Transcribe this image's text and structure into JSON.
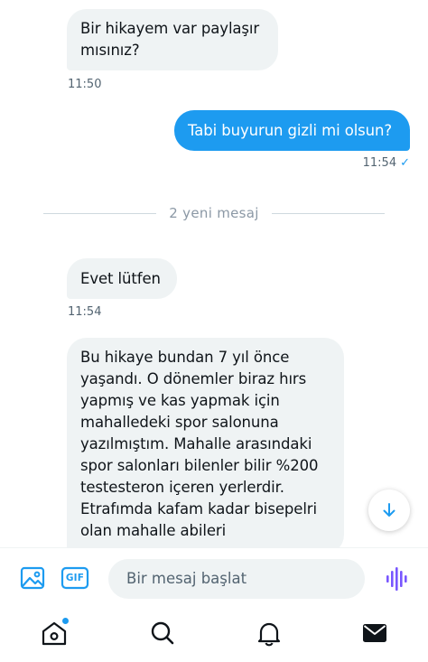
{
  "messages": [
    {
      "id": "m1",
      "direction": "incoming",
      "text": "Bir hikayem var paylaşır mısınız?",
      "time": "11:50"
    },
    {
      "id": "m2",
      "direction": "outgoing",
      "text": "Tabi buyurun gizli mi olsun?",
      "time": "11:54",
      "status_icon": "checkmark-icon"
    },
    {
      "id": "m3",
      "direction": "incoming",
      "text": "Evet lütfen",
      "time": "11:54"
    },
    {
      "id": "m4",
      "direction": "incoming",
      "text": "Bu hikaye bundan 7 yıl önce yaşandı. O dönemler biraz hırs yapmış ve kas yapmak için mahalledeki spor salonuna yazılmıştım. Mahalle arasındaki spor salonları bilenler bilir %200 testesteron içeren yerlerdir. Etrafımda kafam kadar bisepelri olan mahalle abileri"
    }
  ],
  "divider": {
    "label": "2 yeni mesaj"
  },
  "scroll_button": {
    "icon": "arrow-down-icon"
  },
  "composer": {
    "placeholder": "Bir mesaj başlat",
    "gif_label": "GIF",
    "icons": [
      "image-icon",
      "gif-icon",
      "voice-icon"
    ]
  },
  "tabbar": {
    "items": [
      {
        "name": "home",
        "icon": "home-icon",
        "has_notification_dot": true
      },
      {
        "name": "search",
        "icon": "search-icon"
      },
      {
        "name": "notifications",
        "icon": "bell-icon"
      },
      {
        "name": "messages",
        "icon": "mail-icon",
        "active": true
      }
    ]
  },
  "colors": {
    "accent": "#1d9bf0",
    "incoming_bubble": "#eff3f4",
    "text_primary": "#0f1419",
    "text_secondary": "#536471"
  }
}
